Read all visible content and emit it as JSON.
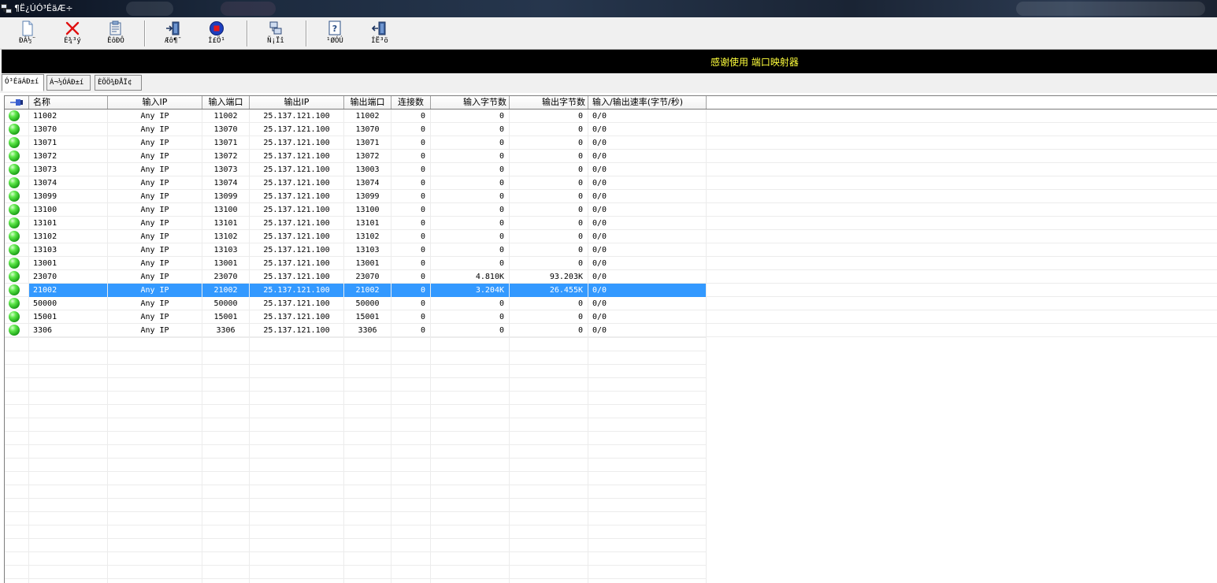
{
  "window": {
    "title": "¶Ë¿ÚÓ³ÉäÆ÷"
  },
  "toolbar": {
    "buttons": [
      {
        "name": "new-button",
        "label": "ÐÂ½¨",
        "icon": "new-document-icon"
      },
      {
        "name": "delete-button",
        "label": "É¾³ý",
        "icon": "delete-x-icon"
      },
      {
        "name": "properties-button",
        "label": "ÊôÐÔ",
        "icon": "properties-icon"
      },
      {
        "name": "start-button",
        "label": "Æô¶¯",
        "icon": "door-enter-icon"
      },
      {
        "name": "stop-button",
        "label": "Í£Ö¹",
        "icon": "stop-icon"
      },
      {
        "name": "options-button",
        "label": "Ñ¡Ïî",
        "icon": "network-computer-icon"
      },
      {
        "name": "about-button",
        "label": "¹ØÓÚ",
        "icon": "help-icon"
      },
      {
        "name": "exit-button",
        "label": "ÍË³ö",
        "icon": "door-exit-icon"
      }
    ]
  },
  "banner": {
    "text": "感谢使用 端口映射器"
  },
  "tabs": [
    {
      "label": "Ó³ÉäÁÐ±í",
      "active": true
    },
    {
      "label": "Á¬½ÓÁÐ±í",
      "active": false
    },
    {
      "label": "ÈÕÖ¾ÐÅÏ¢",
      "active": false
    }
  ],
  "table": {
    "columns": [
      "名称",
      "输入IP",
      "输入端口",
      "输出IP",
      "输出端口",
      "连接数",
      "输入字节数",
      "输出字节数",
      "输入/输出速率(字节/秒)"
    ],
    "rows": [
      [
        "11002",
        "Any IP",
        "11002",
        "25.137.121.100",
        "11002",
        "0",
        "0",
        "0",
        "0/0"
      ],
      [
        "13070",
        "Any IP",
        "13070",
        "25.137.121.100",
        "13070",
        "0",
        "0",
        "0",
        "0/0"
      ],
      [
        "13071",
        "Any IP",
        "13071",
        "25.137.121.100",
        "13071",
        "0",
        "0",
        "0",
        "0/0"
      ],
      [
        "13072",
        "Any IP",
        "13072",
        "25.137.121.100",
        "13072",
        "0",
        "0",
        "0",
        "0/0"
      ],
      [
        "13073",
        "Any IP",
        "13073",
        "25.137.121.100",
        "13003",
        "0",
        "0",
        "0",
        "0/0"
      ],
      [
        "13074",
        "Any IP",
        "13074",
        "25.137.121.100",
        "13074",
        "0",
        "0",
        "0",
        "0/0"
      ],
      [
        "13099",
        "Any IP",
        "13099",
        "25.137.121.100",
        "13099",
        "0",
        "0",
        "0",
        "0/0"
      ],
      [
        "13100",
        "Any IP",
        "13100",
        "25.137.121.100",
        "13100",
        "0",
        "0",
        "0",
        "0/0"
      ],
      [
        "13101",
        "Any IP",
        "13101",
        "25.137.121.100",
        "13101",
        "0",
        "0",
        "0",
        "0/0"
      ],
      [
        "13102",
        "Any IP",
        "13102",
        "25.137.121.100",
        "13102",
        "0",
        "0",
        "0",
        "0/0"
      ],
      [
        "13103",
        "Any IP",
        "13103",
        "25.137.121.100",
        "13103",
        "0",
        "0",
        "0",
        "0/0"
      ],
      [
        "13001",
        "Any IP",
        "13001",
        "25.137.121.100",
        "13001",
        "0",
        "0",
        "0",
        "0/0"
      ],
      [
        "23070",
        "Any IP",
        "23070",
        "25.137.121.100",
        "23070",
        "0",
        "4.810K",
        "93.203K",
        "0/0"
      ],
      [
        "21002",
        "Any IP",
        "21002",
        "25.137.121.100",
        "21002",
        "0",
        "3.204K",
        "26.455K",
        "0/0"
      ],
      [
        "50000",
        "Any IP",
        "50000",
        "25.137.121.100",
        "50000",
        "0",
        "0",
        "0",
        "0/0"
      ],
      [
        "15001",
        "Any IP",
        "15001",
        "25.137.121.100",
        "15001",
        "0",
        "0",
        "0",
        "0/0"
      ],
      [
        "3306",
        "Any IP",
        "3306",
        "25.137.121.100",
        "3306",
        "0",
        "0",
        "0",
        "0/0"
      ]
    ],
    "selected_row_index": 13,
    "status_icon": "green-status-icon"
  },
  "colors": {
    "banner_bg": "#000000",
    "banner_text": "#ffff3c",
    "selection": "#3399ff",
    "status_green": "#2ebd1e"
  }
}
